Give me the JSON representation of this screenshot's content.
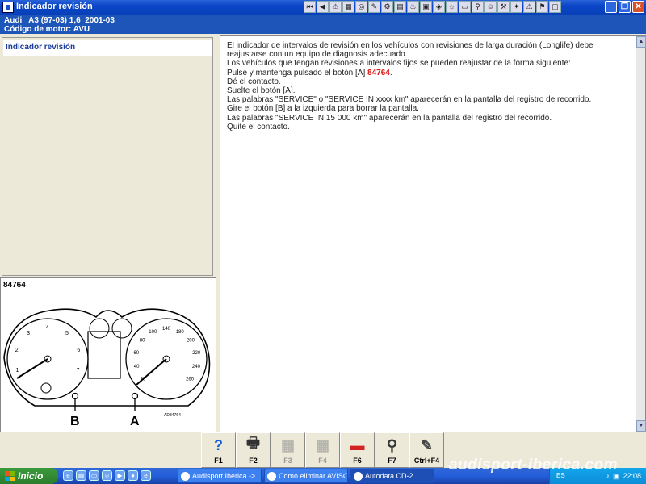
{
  "window": {
    "title": "Indicador revisión"
  },
  "toolbar": {
    "icons": [
      {
        "name": "first-record-icon",
        "glyph": "⏮"
      },
      {
        "name": "previous-icon",
        "glyph": "◀"
      },
      {
        "name": "warning-icon",
        "glyph": "⚠"
      },
      {
        "name": "tool-icon-1",
        "glyph": "▦"
      },
      {
        "name": "tool-icon-2",
        "glyph": "◎"
      },
      {
        "name": "tool-icon-3",
        "glyph": "✎"
      },
      {
        "name": "tool-icon-4",
        "glyph": "⚙"
      },
      {
        "name": "tool-icon-5",
        "glyph": "▤"
      },
      {
        "name": "tool-icon-6",
        "glyph": "♨"
      },
      {
        "name": "tool-icon-7",
        "glyph": "▣"
      },
      {
        "name": "tool-icon-8",
        "glyph": "◈"
      },
      {
        "name": "tool-icon-9",
        "glyph": "☼"
      },
      {
        "name": "tool-icon-10",
        "glyph": "▭"
      },
      {
        "name": "tool-icon-11",
        "glyph": "⚲"
      },
      {
        "name": "tool-icon-12",
        "glyph": "☺"
      },
      {
        "name": "tool-icon-13",
        "glyph": "⚒"
      },
      {
        "name": "tool-icon-14",
        "glyph": "✦"
      },
      {
        "name": "tool-icon-15",
        "glyph": "⚠"
      },
      {
        "name": "tool-icon-16",
        "glyph": "⚑"
      },
      {
        "name": "tool-icon-17",
        "glyph": "▢"
      }
    ]
  },
  "vehicle": {
    "line1": "Audi   A3 (97-03) 1,6  2001-03",
    "line2": "Código de motor: AVU"
  },
  "topics": {
    "selected": "Indicador revisión"
  },
  "diagram": {
    "code": "84764",
    "ref": "AD84764",
    "label_a": "A",
    "label_b": "B",
    "speed_ticks": [
      "20",
      "40",
      "60",
      "80",
      "100",
      "140",
      "180",
      "200",
      "220",
      "240",
      "260"
    ],
    "rpm_ticks": [
      "1",
      "2",
      "3",
      "4",
      "5",
      "6",
      "7"
    ]
  },
  "content": {
    "p1": "El indicador de intervalos de revisión en los vehículos con revisiones de larga duración (Longlife) debe reajustarse con un equipo de diagnosis adecuado.",
    "p2": "Los vehículos que tengan revisiones a intervalos fijos se pueden reajustar de la forma siguiente:",
    "p3_prefix": "Pulse y mantenga pulsado el botón [A] ",
    "p3_code": "84764",
    "p3_suffix": ".",
    "p4": "Dé el contacto.",
    "p5": "Suelte el botón [A].",
    "p6": "Las palabras \"SERVICE\" o \"SERVICE IN xxxx km\" aparecerán en la pantalla del registro de recorrido.",
    "p7": "Gire el botón [B] a la izquierda para borrar la pantalla.",
    "p8": "Las palabras \"SERVICE IN 15 000 km\" aparecerán en la pantalla del registro del recorrido.",
    "p9": "Quite el contacto."
  },
  "function_keys": [
    {
      "name": "f1-help-button",
      "label": "F1",
      "glyph": "?",
      "color": "#1b5fd6",
      "enabled": true
    },
    {
      "name": "f2-print-button",
      "label": "F2",
      "glyph": "🖶",
      "color": "#333333",
      "enabled": true
    },
    {
      "name": "f3-button",
      "label": "F3",
      "glyph": "▦",
      "color": "#777777",
      "enabled": false
    },
    {
      "name": "f4-button",
      "label": "F4",
      "glyph": "▦",
      "color": "#777777",
      "enabled": false
    },
    {
      "name": "f6-button",
      "label": "F6",
      "glyph": "▬",
      "color": "#d22222",
      "enabled": true
    },
    {
      "name": "f7-button",
      "label": "F7",
      "glyph": "⚲",
      "color": "#333333",
      "enabled": true
    },
    {
      "name": "ctrl-f4-button",
      "label": "Ctrl+F4",
      "glyph": "✎",
      "color": "#444444",
      "enabled": true
    }
  ],
  "taskbar": {
    "start_label": "Inicio",
    "tasks": [
      {
        "label": "Audisport Iberica -> ...",
        "active": false
      },
      {
        "label": "Como eliminar AVISO ...",
        "active": false
      },
      {
        "label": "Autodata CD-2",
        "active": true
      }
    ],
    "watermark": "audisport-iberica.com",
    "lang": "ES",
    "clock": "22:08"
  }
}
